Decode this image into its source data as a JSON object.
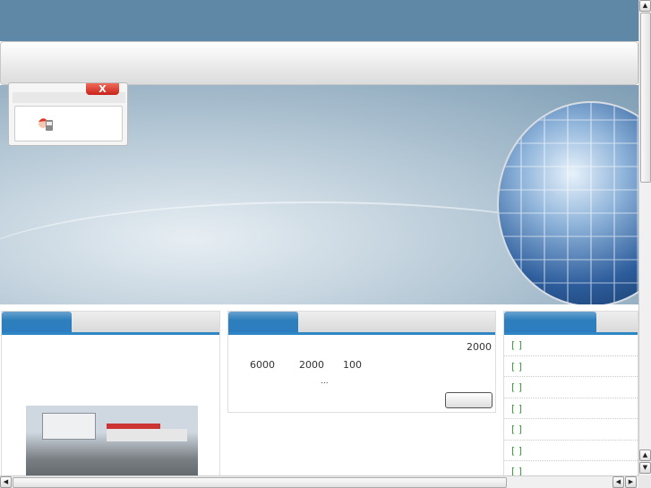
{
  "popup": {
    "close_label": "X",
    "icon": "qq-chat-icon"
  },
  "about_panel": {},
  "info_panel": {
    "line1": "2000",
    "line2_a": "6000",
    "line2_b": "2000",
    "line2_c": "100",
    "ellipsis": "...",
    "more_label": ""
  },
  "news_panel": {
    "items": [
      "[ ]",
      "[ ]",
      "[ ]",
      "[ ]",
      "[ ]",
      "[ ]",
      "[ ]"
    ]
  }
}
